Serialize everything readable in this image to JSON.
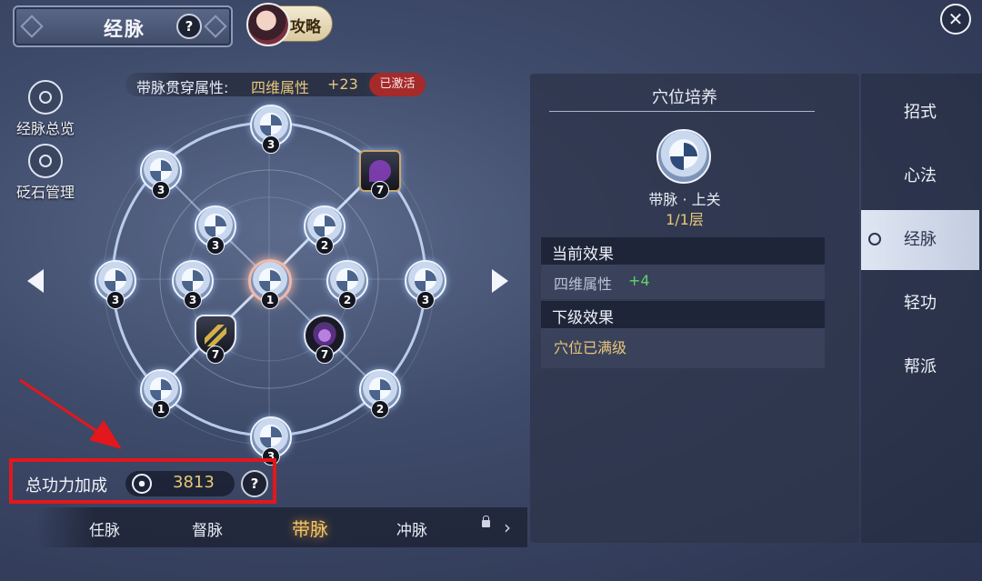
{
  "header": {
    "title": "经脉",
    "help_label": "?",
    "guide_label": "攻略",
    "close_label": "✕"
  },
  "side_tools": [
    {
      "label": "经脉总览",
      "icon": "constellation-icon"
    },
    {
      "label": "砭石管理",
      "icon": "stone-ring-icon"
    }
  ],
  "attribute": {
    "label": "带脉贯穿属性:",
    "value": "四维属性",
    "bonus": "+23",
    "status": "已激活"
  },
  "nodes": [
    {
      "id": "n-top",
      "level": "3",
      "type": "normal"
    },
    {
      "id": "n-ul",
      "level": "3",
      "type": "normal"
    },
    {
      "id": "n-ur",
      "level": "7",
      "type": "square"
    },
    {
      "id": "n-il",
      "level": "3",
      "type": "normal"
    },
    {
      "id": "n-ir",
      "level": "2",
      "type": "normal"
    },
    {
      "id": "n-l",
      "level": "3",
      "type": "normal"
    },
    {
      "id": "n-ml",
      "level": "3",
      "type": "normal"
    },
    {
      "id": "n-c",
      "level": "1",
      "type": "center"
    },
    {
      "id": "n-mr",
      "level": "2",
      "type": "normal"
    },
    {
      "id": "n-r",
      "level": "3",
      "type": "normal"
    },
    {
      "id": "n-sl",
      "level": "7",
      "type": "shield"
    },
    {
      "id": "n-sr",
      "level": "7",
      "type": "dark"
    },
    {
      "id": "n-ll",
      "level": "1",
      "type": "normal"
    },
    {
      "id": "n-lr",
      "level": "2",
      "type": "normal"
    },
    {
      "id": "n-b",
      "level": "3",
      "type": "normal"
    }
  ],
  "power": {
    "label": "总功力加成",
    "value": "3813",
    "help_label": "?"
  },
  "meridian_tabs": [
    "任脉",
    "督脉",
    "带脉",
    "冲脉"
  ],
  "active_tab": "带脉",
  "panel": {
    "title": "穴位培养",
    "node_name": "带脉 · 上关",
    "node_level": "1/1层",
    "current_effect_header": "当前效果",
    "current_effect_name": "四维属性",
    "current_effect_value": "+4",
    "next_effect_header": "下级效果",
    "next_effect_text": "穴位已满级"
  },
  "right_nav": [
    "招式",
    "心法",
    "经脉",
    "轻功",
    "帮派"
  ],
  "right_nav_active": "经脉",
  "colors": {
    "highlight": "#e3171c",
    "gold": "#e8c679",
    "green": "#5fd46a"
  }
}
